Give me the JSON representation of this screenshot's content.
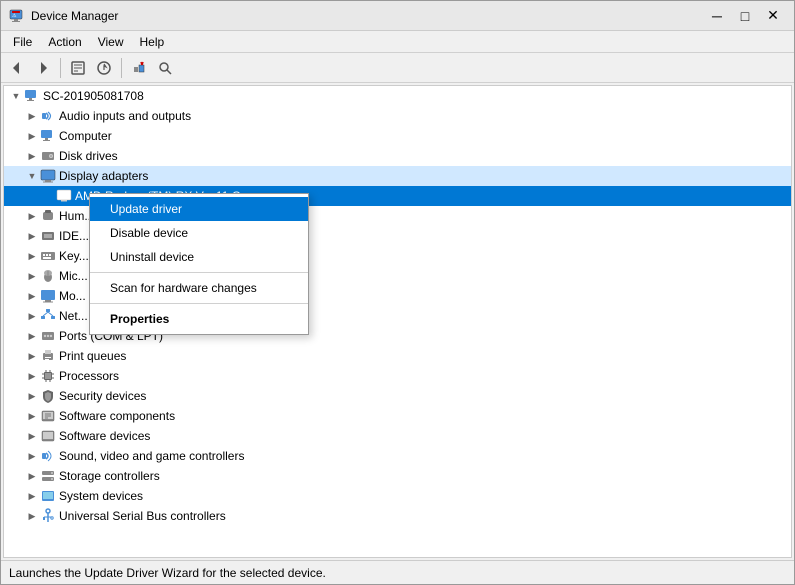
{
  "window": {
    "title": "Device Manager",
    "minimize": "─",
    "maximize": "□",
    "close": "✕"
  },
  "menu": {
    "items": [
      "File",
      "Action",
      "View",
      "Help"
    ]
  },
  "toolbar": {
    "buttons": [
      {
        "name": "back",
        "icon": "◀",
        "tooltip": "Back"
      },
      {
        "name": "forward",
        "icon": "▶",
        "tooltip": "Forward"
      },
      {
        "name": "properties",
        "icon": "🔲",
        "tooltip": "Properties"
      },
      {
        "name": "update",
        "icon": "🔄",
        "tooltip": "Update Driver Software"
      },
      {
        "name": "uninstall",
        "icon": "❌",
        "tooltip": "Uninstall"
      },
      {
        "name": "scan",
        "icon": "🔍",
        "tooltip": "Scan for hardware changes"
      }
    ]
  },
  "tree": {
    "root": "SC-201905081708",
    "items": [
      {
        "id": "root",
        "label": "SC-201905081708",
        "indent": 0,
        "expanded": true,
        "type": "computer",
        "expander": "▼"
      },
      {
        "id": "audio",
        "label": "Audio inputs and outputs",
        "indent": 1,
        "expanded": false,
        "type": "folder",
        "expander": "▶"
      },
      {
        "id": "computer",
        "label": "Computer",
        "indent": 1,
        "expanded": false,
        "type": "computer2",
        "expander": "▶"
      },
      {
        "id": "disk",
        "label": "Disk drives",
        "indent": 1,
        "expanded": false,
        "type": "disk",
        "expander": "▶"
      },
      {
        "id": "display",
        "label": "Display adapters",
        "indent": 1,
        "expanded": true,
        "type": "monitor",
        "expander": "▼",
        "highlighted": true
      },
      {
        "id": "display-child",
        "label": "AMD Radeon(TM) RX V... 11 Gra...",
        "indent": 2,
        "expanded": false,
        "type": "monitor",
        "expander": "",
        "selected": true
      },
      {
        "id": "hum",
        "label": "Hum...",
        "indent": 1,
        "expanded": false,
        "type": "device",
        "expander": "▶"
      },
      {
        "id": "ide",
        "label": "IDE...",
        "indent": 1,
        "expanded": false,
        "type": "device",
        "expander": "▶"
      },
      {
        "id": "key",
        "label": "Key...",
        "indent": 1,
        "expanded": false,
        "type": "keyboard",
        "expander": "▶"
      },
      {
        "id": "mic",
        "label": "Mic...",
        "indent": 1,
        "expanded": false,
        "type": "device",
        "expander": "▶"
      },
      {
        "id": "mo",
        "label": "Mo...",
        "indent": 1,
        "expanded": false,
        "type": "device",
        "expander": "▶"
      },
      {
        "id": "net",
        "label": "Net...",
        "indent": 1,
        "expanded": false,
        "type": "network",
        "expander": "▶"
      },
      {
        "id": "ports",
        "label": "Ports (COM & LPT)",
        "indent": 1,
        "expanded": false,
        "type": "device",
        "expander": "▶"
      },
      {
        "id": "print",
        "label": "Print queues",
        "indent": 1,
        "expanded": false,
        "type": "print",
        "expander": "▶"
      },
      {
        "id": "proc",
        "label": "Processors",
        "indent": 1,
        "expanded": false,
        "type": "chip",
        "expander": "▶"
      },
      {
        "id": "security",
        "label": "Security devices",
        "indent": 1,
        "expanded": false,
        "type": "security",
        "expander": "▶"
      },
      {
        "id": "software-comp",
        "label": "Software components",
        "indent": 1,
        "expanded": false,
        "type": "software",
        "expander": "▶"
      },
      {
        "id": "software-dev",
        "label": "Software devices",
        "indent": 1,
        "expanded": false,
        "type": "software",
        "expander": "▶"
      },
      {
        "id": "sound",
        "label": "Sound, video and game controllers",
        "indent": 1,
        "expanded": false,
        "type": "sound",
        "expander": "▶"
      },
      {
        "id": "storage",
        "label": "Storage controllers",
        "indent": 1,
        "expanded": false,
        "type": "storage",
        "expander": "▶"
      },
      {
        "id": "system",
        "label": "System devices",
        "indent": 1,
        "expanded": false,
        "type": "device",
        "expander": "▶"
      },
      {
        "id": "usb",
        "label": "Universal Serial Bus controllers",
        "indent": 1,
        "expanded": false,
        "type": "usb",
        "expander": "▶"
      }
    ]
  },
  "context_menu": {
    "items": [
      {
        "id": "update",
        "label": "Update driver",
        "bold": false,
        "selected": true,
        "separator_after": false
      },
      {
        "id": "disable",
        "label": "Disable device",
        "bold": false,
        "selected": false,
        "separator_after": false
      },
      {
        "id": "uninstall",
        "label": "Uninstall device",
        "bold": false,
        "selected": false,
        "separator_after": true
      },
      {
        "id": "scan",
        "label": "Scan for hardware changes",
        "bold": false,
        "selected": false,
        "separator_after": true
      },
      {
        "id": "properties",
        "label": "Properties",
        "bold": true,
        "selected": false,
        "separator_after": false
      }
    ]
  },
  "status_bar": {
    "text": "Launches the Update Driver Wizard for the selected device."
  }
}
